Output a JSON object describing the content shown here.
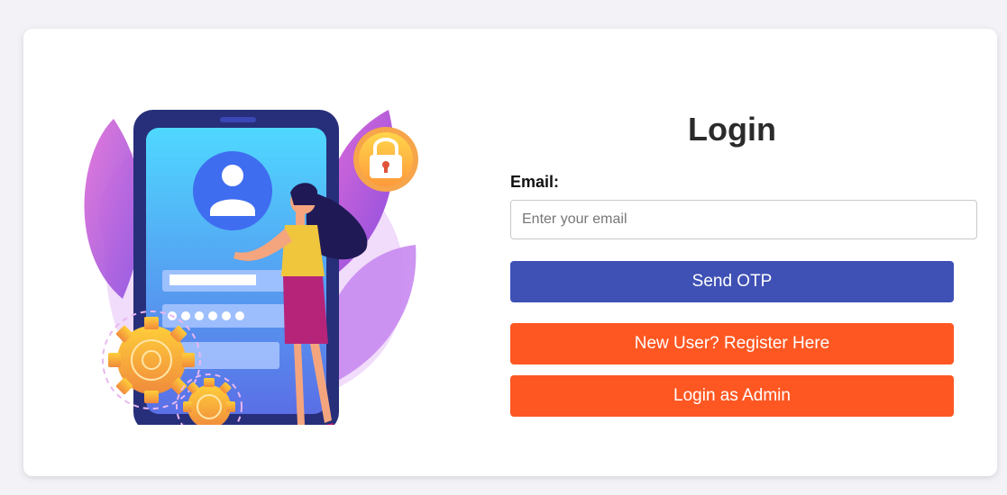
{
  "login": {
    "title": "Login",
    "email_label": "Email:",
    "email_placeholder": "Enter your email",
    "email_value": "",
    "send_otp_label": "Send OTP",
    "register_label": "New User? Register Here",
    "admin_label": "Login as Admin"
  },
  "colors": {
    "primary": "#3f51b5",
    "accent": "#ff5722",
    "background": "#f3f3f7",
    "card": "#ffffff"
  },
  "illustration": {
    "name": "mobile-login-illustration",
    "icons": [
      "user-avatar-icon",
      "padlock-icon",
      "gear-icon",
      "woman-figure"
    ]
  }
}
